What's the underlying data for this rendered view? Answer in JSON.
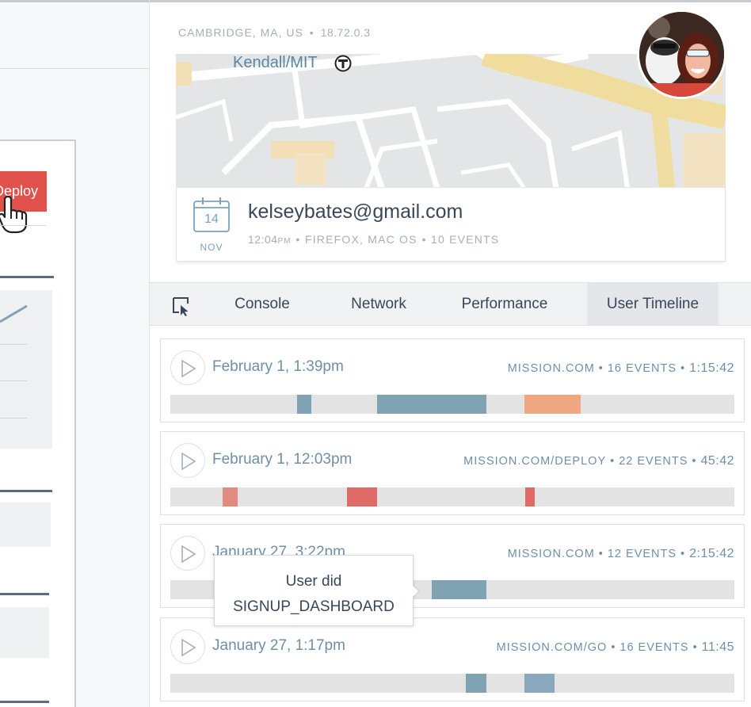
{
  "left_app": {
    "deploy_button_label": "Deploy"
  },
  "header": {
    "location": "CAMBRIDGE, MA, US",
    "ip": "18.72.0.3"
  },
  "map": {
    "station_label": "Kendall/MIT"
  },
  "user": {
    "email": "kelseybates@gmail.com",
    "date_day": "14",
    "date_month": "NOV",
    "time": "12:04",
    "ampm": "PM",
    "browser": "FIREFOX, MAC OS",
    "events": "10 EVENTS"
  },
  "tabs": [
    {
      "label": "Console",
      "active": false
    },
    {
      "label": "Network",
      "active": false
    },
    {
      "label": "Performance",
      "active": false
    },
    {
      "label": "User Timeline",
      "active": true
    }
  ],
  "sessions": [
    {
      "date": "February 1, 1:39pm",
      "site": "MISSION.COM",
      "events": "16 EVENTS",
      "duration": "1:15:42",
      "segments": [
        {
          "start": 0.225,
          "end": 0.25,
          "color": "#7fa3b3"
        },
        {
          "start": 0.366,
          "end": 0.56,
          "color": "#7fa3b3"
        },
        {
          "start": 0.628,
          "end": 0.728,
          "color": "#f0a882"
        }
      ]
    },
    {
      "date": "February 1, 12:03pm",
      "site": "MISSION.COM/DEPLOY",
      "events": "22 EVENTS",
      "duration": "45:42",
      "segments": [
        {
          "start": 0.092,
          "end": 0.119,
          "color": "#e08a80"
        },
        {
          "start": 0.313,
          "end": 0.366,
          "color": "#e06a66"
        },
        {
          "start": 0.629,
          "end": 0.646,
          "color": "#e06a66"
        }
      ]
    },
    {
      "date": "January 27, 3:22pm",
      "site": "MISSION.COM",
      "events": "12 EVENTS",
      "duration": "2:15:42",
      "segments": [
        {
          "start": 0.463,
          "end": 0.56,
          "color": "#7fa3b3"
        }
      ]
    },
    {
      "date": "January 27, 1:17pm",
      "site": "MISSION.COM/GO",
      "events": "16 EVENTS",
      "duration": "11:45",
      "segments": [
        {
          "start": 0.524,
          "end": 0.56,
          "color": "#7fa3b3"
        },
        {
          "start": 0.628,
          "end": 0.681,
          "color": "#8aa8bb"
        }
      ]
    }
  ],
  "tooltip": {
    "line1": "User did",
    "line2": "SIGNUP_DASHBOARD"
  },
  "colors": {
    "accent_blue": "#7fa3b3",
    "accent_red": "#e0524b",
    "accent_orange": "#f0a882"
  }
}
